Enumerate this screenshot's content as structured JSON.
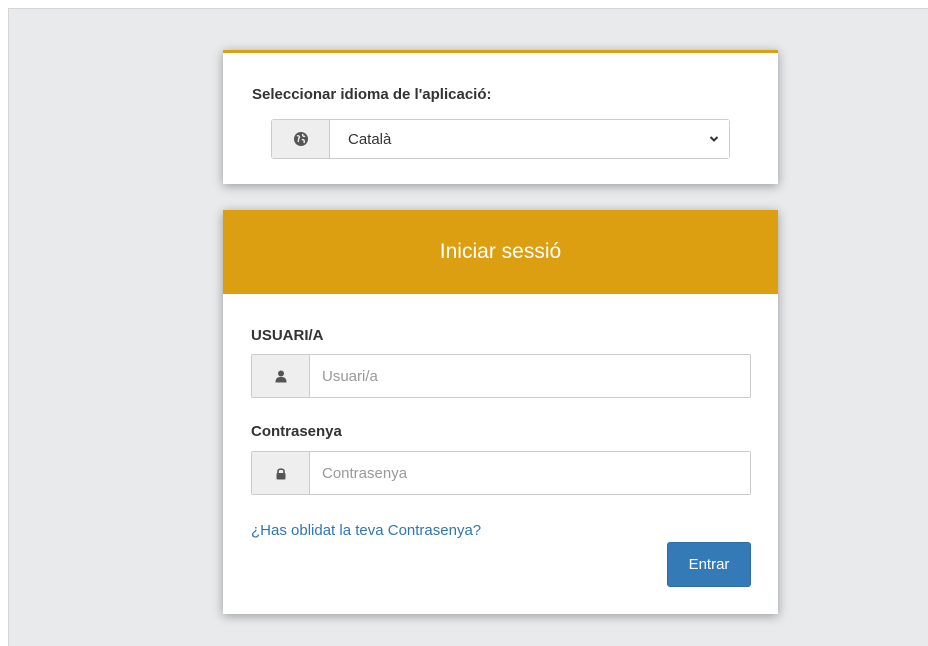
{
  "language_panel": {
    "label": "Seleccionar idioma de l'aplicació:",
    "selected_language": "Català",
    "icon": "globe-icon"
  },
  "login": {
    "title": "Iniciar sessió",
    "username": {
      "label": "USUARI/A",
      "placeholder": "Usuari/a",
      "value": "",
      "icon": "user-icon"
    },
    "password": {
      "label": "Contrasenya",
      "placeholder": "Contrasenya",
      "value": "",
      "icon": "lock-icon"
    },
    "forgot_link": "¿Has oblidat la teva Contrasenya?",
    "submit_label": "Entrar"
  },
  "colors": {
    "accent": "#dc9f12",
    "primary_button": "#337ab7",
    "link": "#2e76b6",
    "background": "#e9eaec"
  }
}
